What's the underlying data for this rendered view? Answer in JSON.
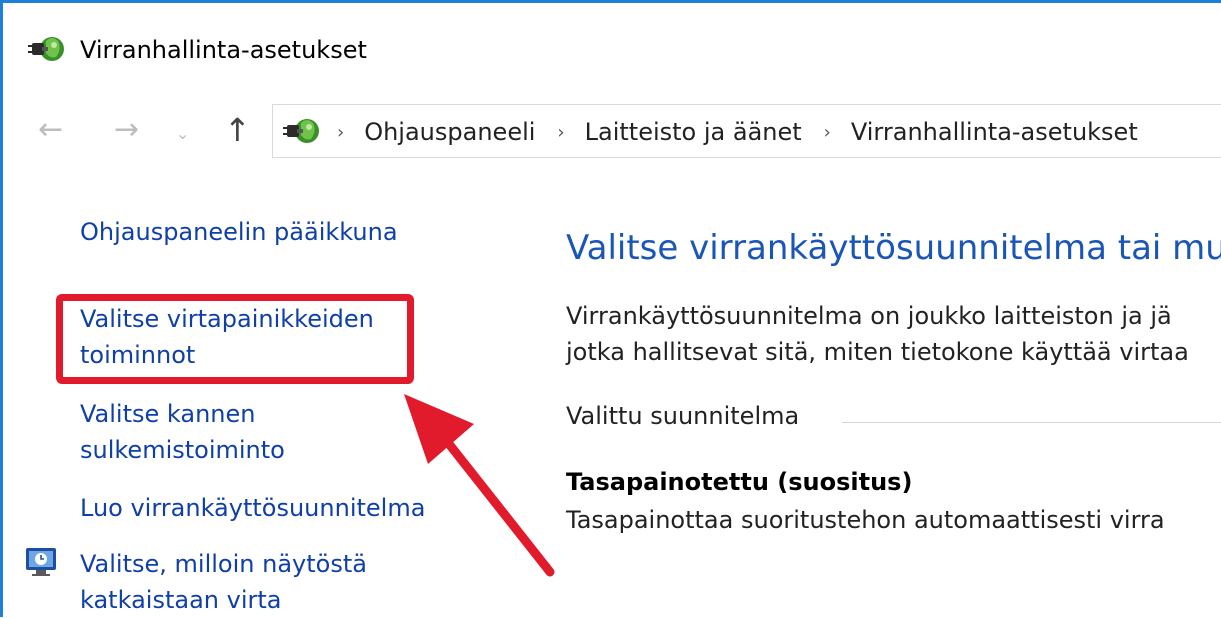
{
  "window": {
    "title": "Virranhallinta-asetukset",
    "accent_color": "#1e7fd8",
    "icon": "power-options-icon"
  },
  "nav": {
    "back_icon": "←",
    "forward_icon": "→",
    "recent_icon": "⌄",
    "up_icon": "↑",
    "separator": "›",
    "breadcrumbs": [
      "Ohjauspaneeli",
      "Laitteisto ja äänet",
      "Virranhallinta-asetukset"
    ]
  },
  "sidebar": {
    "home_link": "Ohjauspaneelin pääikkuna",
    "items": [
      {
        "line1": "Valitse virtapainikkeiden",
        "line2": "toiminnot"
      },
      {
        "line1": "Valitse kannen",
        "line2": "sulkemistoiminto"
      },
      {
        "line1": "Luo virrankäyttösuunnitelma"
      },
      {
        "line1": "Valitse, milloin näytöstä",
        "line2": "katkaistaan virta",
        "icon": "monitor-clock-icon"
      }
    ],
    "highlight_color": "#e21b2c",
    "link_color": "#0f3fa8"
  },
  "main": {
    "heading": "Valitse virrankäyttösuunnitelma tai mu",
    "description_line1": "Virrankäyttösuunnitelma on joukko laitteiston ja jä",
    "description_line2": "jotka hallitsevat sitä, miten tietokone käyttää virtaa",
    "section_label": "Valittu suunnitelma",
    "plan_name": "Tasapainotettu (suositus)",
    "plan_description": "Tasapainottaa suoritustehon automaattisesti virra",
    "heading_color": "#1a56b8"
  },
  "annotation": {
    "arrow_color": "#e21b2c"
  }
}
